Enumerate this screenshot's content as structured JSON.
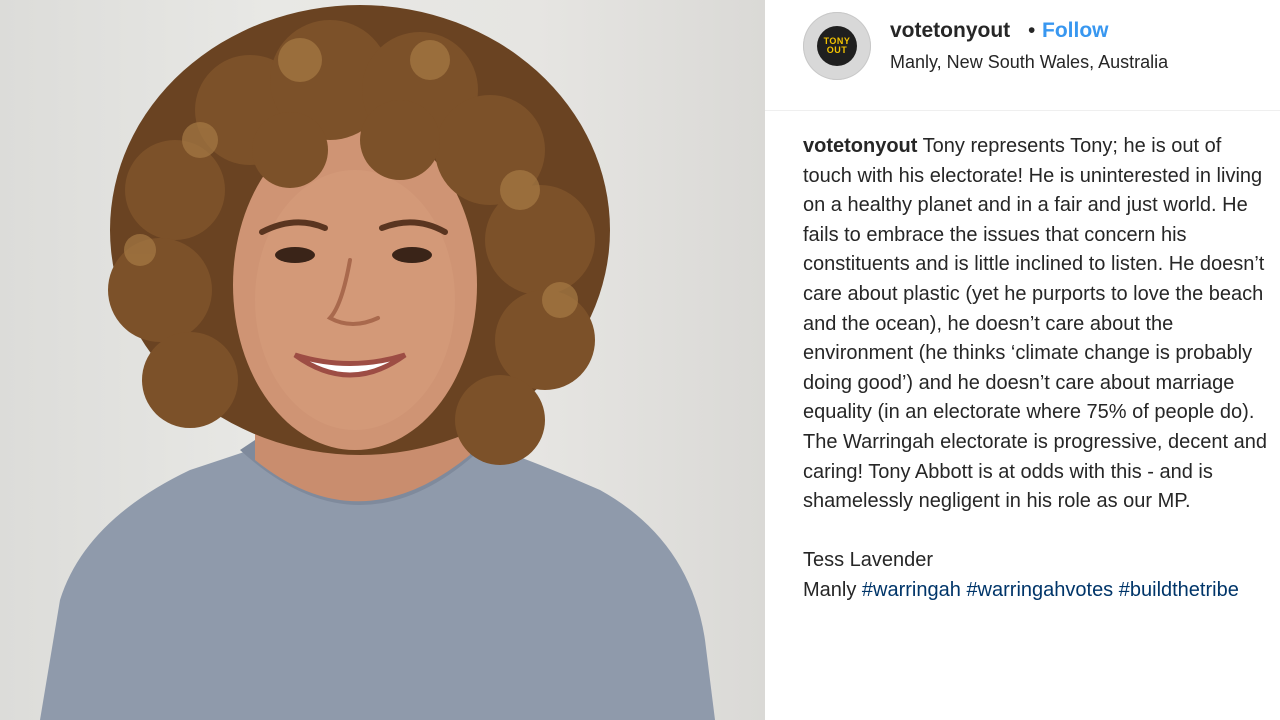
{
  "post": {
    "author": {
      "username": "votetonyout",
      "location": "Manly, New South Wales, Australia",
      "avatar_badge": [
        "TONY",
        "OUT"
      ],
      "follow_label": "Follow",
      "separator": "•"
    },
    "caption": {
      "username": "votetonyout",
      "text": "Tony represents Tony; he is out of touch with his electorate! He is uninterested in living on a healthy planet and in a fair and just world. He fails to embrace the issues that concern his constituents and is little inclined to listen. He doesn’t care about plastic (yet he purports to love the beach and the ocean), he doesn’t care about the environment (he thinks ‘climate change is probably doing good’) and he doesn’t care about marriage equality (in an electorate where 75% of people do). The Warringah electorate is progressive, decent and caring! Tony Abbott is at odds with this - and is shamelessly negligent in his role as our MP.",
      "signature_name": "Tess Lavender",
      "signature_place": "Manly",
      "hashtags": [
        "#warringah",
        "#warringahvotes",
        "#buildthetribe"
      ]
    },
    "colors": {
      "link_blue": "#3897f0",
      "hashtag": "#003569",
      "text": "#262626"
    }
  }
}
